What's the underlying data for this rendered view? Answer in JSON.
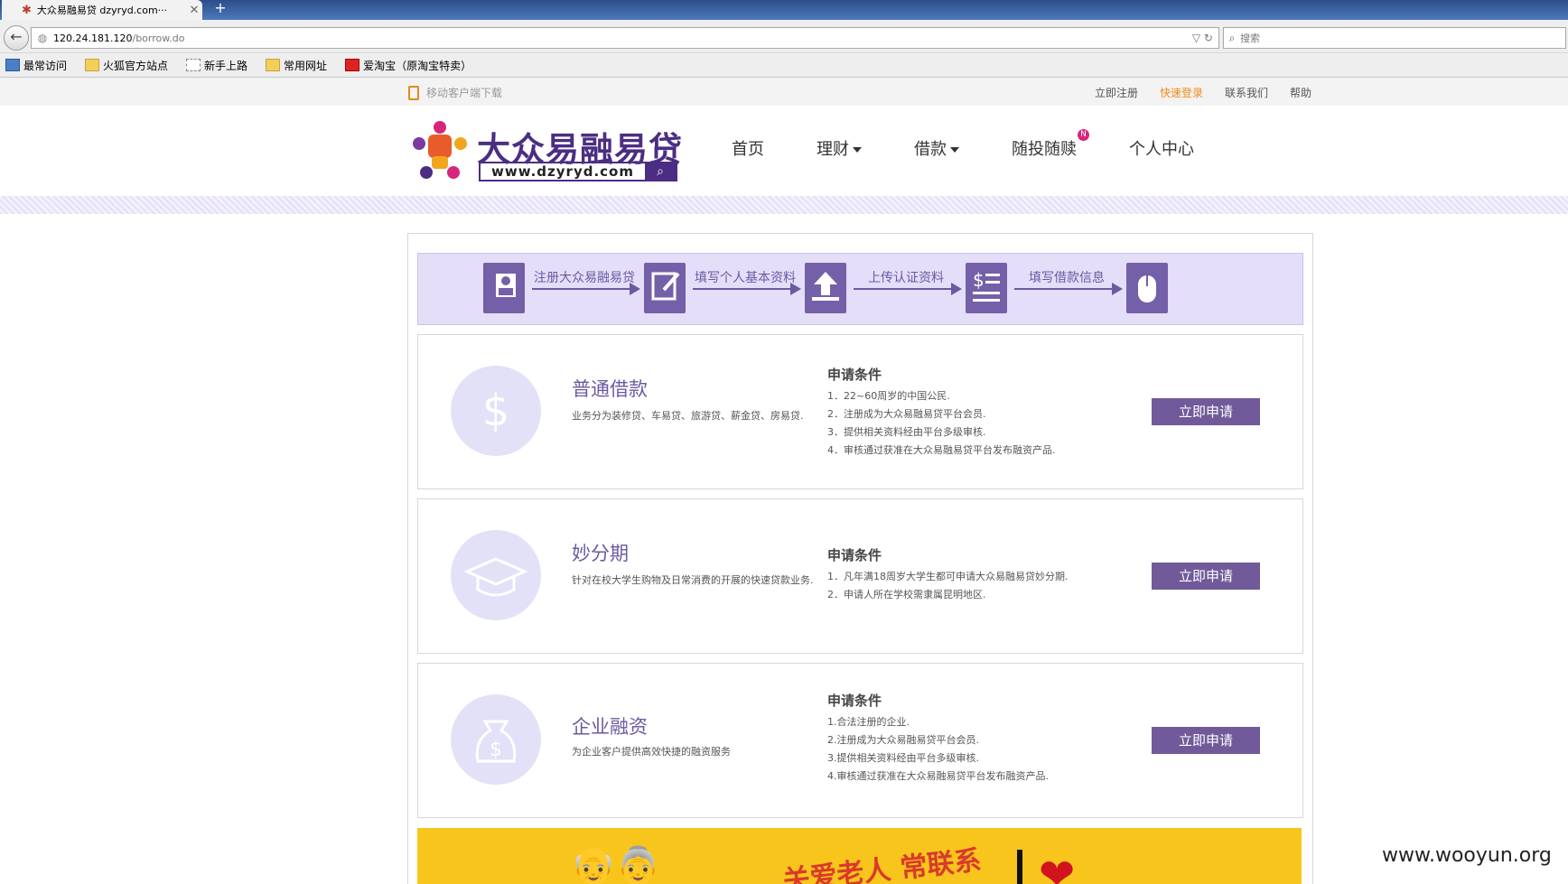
{
  "browser": {
    "tab_title": "大众易融易贷 dzyryd.com···",
    "url_host": "120.24.181.120",
    "url_path": "/borrow.do",
    "search_placeholder": "搜索",
    "bookmarks": [
      "最常访问",
      "火狐官方站点",
      "新手上路",
      "常用网址",
      "爱淘宝（原淘宝特卖）"
    ]
  },
  "topbar": {
    "mobile_download": "移动客户端下载",
    "links": [
      "立即注册",
      "快速登录",
      "联系我们",
      "帮助"
    ],
    "active_link_color": "#ef8b16"
  },
  "header": {
    "brand": "大众易融易贷",
    "domain": "www.dzyryd.com",
    "nav": [
      "首页",
      "理财",
      "借款",
      "随投随赎",
      "个人中心"
    ],
    "nav_badge": "N"
  },
  "steps": [
    "注册大众易融易贷",
    "填写个人基本资料",
    "上传认证资料",
    "填写借款信息"
  ],
  "products": [
    {
      "title": "普通借款",
      "desc": "业务分为装修贷、车易贷、旅游贷、薪金贷、房易贷.",
      "cond_title": "申请条件",
      "conditions": [
        "1．22~60周岁的中国公民.",
        "2．注册成为大众易融易贷平台会员.",
        "3．提供相关资料经由平台多级审核.",
        "4．审核通过获准在大众易融易贷平台发布融资产品."
      ],
      "button": "立即申请",
      "icon": "dollar-icon"
    },
    {
      "title": "妙分期",
      "desc": "针对在校大学生购物及日常消费的开展的快速贷款业务.",
      "cond_title": "申请条件",
      "conditions": [
        "1．凡年满18周岁大学生都可申请大众易融易贷妙分期.",
        "2．申请人所在学校需隶属昆明地区."
      ],
      "button": "立即申请",
      "icon": "graduation-cap-icon"
    },
    {
      "title": "企业融资",
      "desc": "为企业客户提供高效快捷的融资服务",
      "cond_title": "申请条件",
      "conditions": [
        "1.合法注册的企业.",
        "2.注册成为大众易融易贷平台会员.",
        "3.提供相关资料经由平台多级审核.",
        "4.审核通过获准在大众易融易贷平台发布融资产品."
      ],
      "button": "立即申请",
      "icon": "money-bag-icon"
    }
  ],
  "banner": {
    "slogan": "关爱老人 常联系"
  },
  "watermark": "www.wooyun.org",
  "colors": {
    "brand_purple": "#4b2e83",
    "accent_purple": "#705a9a",
    "banner_yellow": "#f8c51c"
  }
}
